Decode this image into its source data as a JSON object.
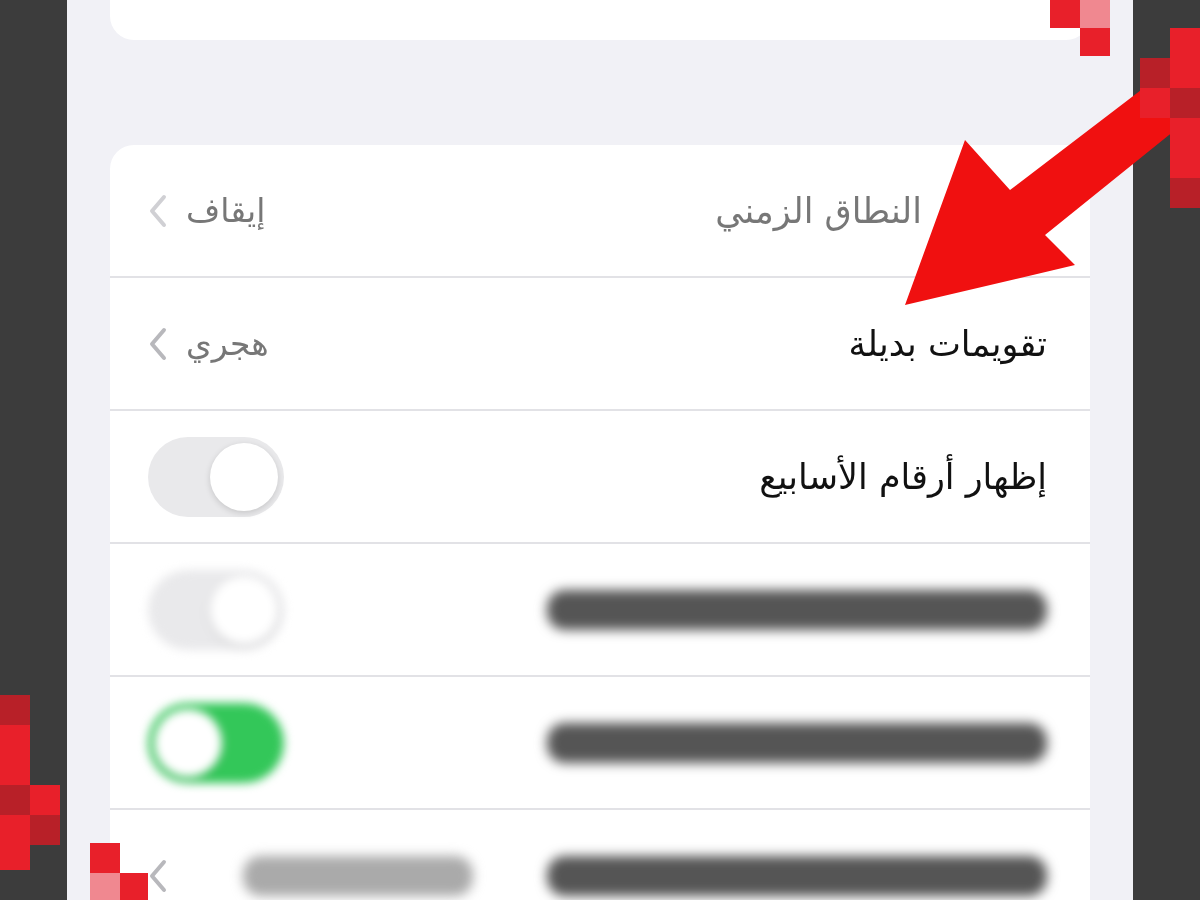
{
  "settings_rows": [
    {
      "kind": "link",
      "label": "النطاق الزمني",
      "value": "إيقاف",
      "dimmed": true
    },
    {
      "kind": "link",
      "label": "تقويمات بديلة",
      "value": "هجري",
      "dimmed": false
    },
    {
      "kind": "toggle",
      "label": "إظهار أرقام الأسابيع",
      "on": false,
      "blurred": false
    },
    {
      "kind": "toggle",
      "on": false,
      "blurred": true
    },
    {
      "kind": "toggle",
      "on": true,
      "blurred": true
    },
    {
      "kind": "link",
      "blurred": true
    }
  ]
}
